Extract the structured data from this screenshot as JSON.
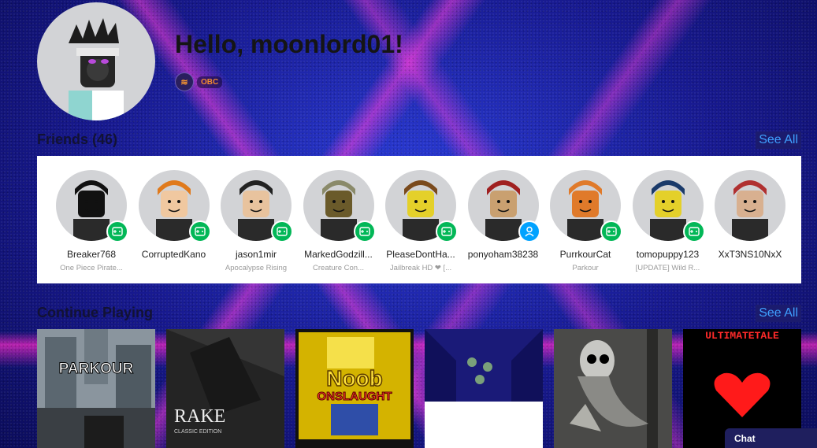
{
  "user": {
    "greeting": "Hello, moonlord01!",
    "badge_label": "OBC"
  },
  "friends": {
    "title": "Friends (46)",
    "see_all": "See All",
    "items": [
      {
        "name": "Breaker768",
        "game": "One Piece Pirate...",
        "status": "in-game",
        "hair": "#111",
        "skin": "#111"
      },
      {
        "name": "CorruptedKano",
        "game": "",
        "status": "in-game",
        "hair": "#e07a1c",
        "skin": "#f0c8a0"
      },
      {
        "name": "jason1mir",
        "game": "Apocalypse Rising",
        "status": "in-game",
        "hair": "#222",
        "skin": "#e8c39e"
      },
      {
        "name": "MarkedGodzill...",
        "game": "Creature Con...",
        "status": "in-game",
        "hair": "#8a8a6a",
        "skin": "#6a5a2a"
      },
      {
        "name": "PleaseDontHa...",
        "game": "Jailbreak HD ❤ [...",
        "status": "in-game",
        "hair": "#7a4a1c",
        "skin": "#e4d02a"
      },
      {
        "name": "ponyoham38238",
        "game": "",
        "status": "online",
        "hair": "#a02020",
        "skin": "#c9a070"
      },
      {
        "name": "PurrkourCat",
        "game": "Parkour",
        "status": "in-game",
        "hair": "#e07a2a",
        "skin": "#e07a2a"
      },
      {
        "name": "tomopuppy123",
        "game": "[UPDATE] Wild R...",
        "status": "in-game",
        "hair": "#1a3a6a",
        "skin": "#e4d02a"
      },
      {
        "name": "XxT3NS10NxX",
        "game": "",
        "status": "none",
        "hair": "#b03030",
        "skin": "#d8b090"
      }
    ]
  },
  "continue_playing": {
    "title": "Continue Playing",
    "see_all": "See All",
    "games": [
      {
        "label": "PARKOUR",
        "bg": "#7e8a93"
      },
      {
        "label": "RAKE",
        "sub": "CLASSIC EDITION",
        "bg": "#2a2a2a"
      },
      {
        "label": "Noob",
        "sub": "ONSLAUGHT",
        "bg": "#c8a800"
      },
      {
        "label": "",
        "bg": "#1a1a6a"
      },
      {
        "label": "",
        "bg": "#4a4a48"
      },
      {
        "label": "ULTIMATETALE",
        "bg": "#000000"
      }
    ]
  },
  "chat": {
    "label": "Chat"
  },
  "colors": {
    "in_game": "#02b757",
    "online": "#00a2ff",
    "see_all_text": "#3fa0ff"
  }
}
